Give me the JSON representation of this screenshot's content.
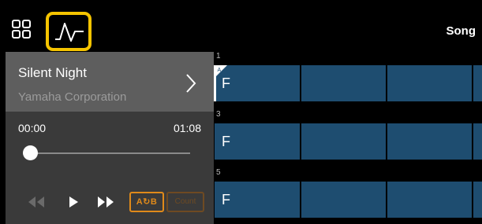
{
  "header": {
    "title": "Song",
    "active_highlight_color": "#f5c400"
  },
  "song": {
    "title": "Silent Night",
    "artist": "Yamaha Corporation"
  },
  "player": {
    "time_current": "00:00",
    "time_total": "01:08",
    "position_fraction": 0.0,
    "ab_label": "A↻B",
    "count_label": "Count"
  },
  "chart": {
    "rows": [
      {
        "number": "1",
        "section": "A",
        "bars": [
          "F",
          "",
          "",
          ""
        ]
      },
      {
        "number": "3",
        "bars": [
          "F",
          "",
          "",
          ""
        ]
      },
      {
        "number": "5",
        "bars": [
          "F",
          "",
          "",
          ""
        ]
      }
    ]
  },
  "colors": {
    "bar": "#1e4d70",
    "accent_orange": "#e08a1a",
    "panel": "#3a3a3a",
    "song_info_bg": "#5e5e5e"
  }
}
